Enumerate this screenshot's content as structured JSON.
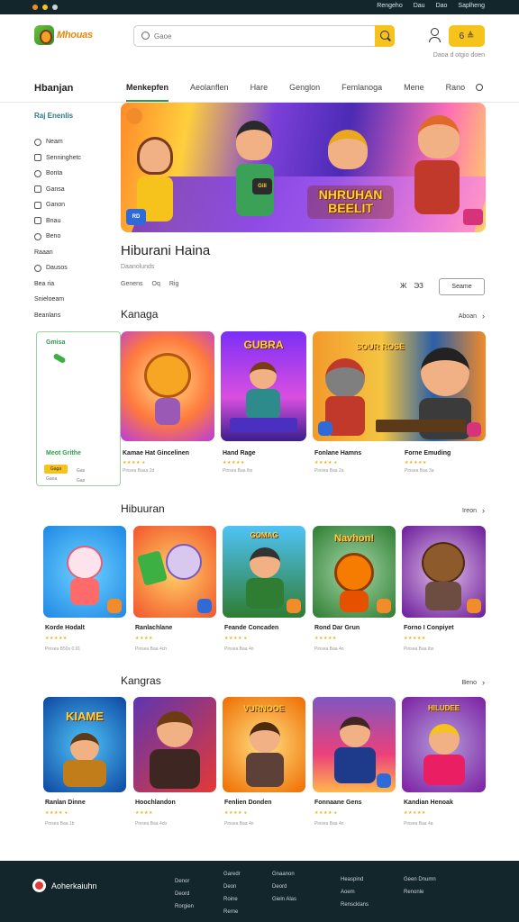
{
  "colors": {
    "topbar": "#13262b",
    "accent": "#f6c21c",
    "green": "#2e9d4a",
    "teal": "#2b7a8c"
  },
  "topbar": {
    "links": [
      "Rengeho",
      "Dau",
      "Dao",
      "Saplheng"
    ]
  },
  "header": {
    "logo_text": "Mhouas",
    "search_placeholder": "Gaoe",
    "cart_label": "6 ≜",
    "sub_note": "Daoa d otgio doen"
  },
  "nav": {
    "side_title": "Hbanjan",
    "tabs": [
      "Menkepfen",
      "Aeolanflen",
      "Hare",
      "Genglon",
      "Femlanoga",
      "Mene",
      "Rano"
    ]
  },
  "sidebar": {
    "head": "Raj Enenlis",
    "items": [
      {
        "label": "Neam",
        "icon": "clock-icon"
      },
      {
        "label": "Senninghetc",
        "icon": "grid-icon"
      },
      {
        "label": "Bonta",
        "icon": "compass-icon"
      },
      {
        "label": "Gansa",
        "icon": "folder-icon"
      },
      {
        "label": "Ganon",
        "icon": "calendar-icon"
      },
      {
        "label": "Bnau",
        "icon": "image-icon"
      },
      {
        "label": "Beno",
        "icon": "settings-icon"
      },
      {
        "label": "Raaan",
        "icon": ""
      },
      {
        "label": "Dausos",
        "icon": "help-icon"
      },
      {
        "label": "Bea ria",
        "icon": ""
      },
      {
        "label": "Snieloeam",
        "icon": ""
      },
      {
        "label": "Beanlans",
        "icon": ""
      }
    ]
  },
  "hero": {
    "title": "NHRUHAN BEELIT",
    "badge_left": "RD",
    "sign": "Gill"
  },
  "detail": {
    "title": "Hiburani Haina",
    "rating": "Daanolunds",
    "meta": [
      "Genens",
      "Oq",
      "Rig"
    ],
    "share": [
      "Ж",
      "ЭЗ"
    ],
    "button": "Seame"
  },
  "sections": [
    {
      "title": "Kanaga",
      "see_all": "Aboan",
      "promo": {
        "title": "Gmisa",
        "name": "Meot Grithe",
        "badge": "Gaga",
        "meta": "Gaoa",
        "meta2": "Gas\nGas"
      },
      "cards": [
        {
          "name": "Kamae Hat Gincelinen",
          "stars": "★★★★ ●",
          "sub": "Pinsea Baaa 2d",
          "label": ""
        },
        {
          "name": "Hand Rage",
          "stars": "★★★★★",
          "sub": "Pinsea Baa lbs",
          "label": "GUBRA"
        },
        {
          "name": "Fonlane Hamns",
          "stars": "★★★★ ●",
          "sub": "Pinsea Baa 2a",
          "label": "SOUR ROSE"
        },
        {
          "name": "Forne Emuding",
          "stars": "★★★★★",
          "sub": "Pinsea Baa 3a",
          "label": ""
        }
      ]
    },
    {
      "title": "Hibuuran",
      "see_all": "Ireon",
      "cards": [
        {
          "name": "Korde Hodalt",
          "stars": "★★★★★",
          "sub": "Pinsea B50s 0.91",
          "label": ""
        },
        {
          "name": "Ranlachlane",
          "stars": "★★★★",
          "sub": "Pinsea Baa 4ch",
          "label": ""
        },
        {
          "name": "Feande Concaden",
          "stars": "★★★★ ●",
          "sub": "Pinsea Baa 4n",
          "label": "GOMAG"
        },
        {
          "name": "Rond Dar Grun",
          "stars": "★★★★★",
          "sub": "Pinsea Baa 4n",
          "label": "Navhon!"
        },
        {
          "name": "Forno I Conpiyet",
          "stars": "★★★★★",
          "sub": "Pinsea Baa lbs",
          "label": ""
        }
      ]
    },
    {
      "title": "Kangras",
      "see_all": "Beno",
      "cards": [
        {
          "name": "Ranlan Dinne",
          "stars": "★★★★ ●",
          "sub": "Pinsea Baa 1b",
          "label": "KIAME"
        },
        {
          "name": "Hoochlandon",
          "stars": "★★★★",
          "sub": "Pinsea Baa 4cb",
          "label": ""
        },
        {
          "name": "Fenlien Donden",
          "stars": "★★★★ ●",
          "sub": "Pinsea Baa 4n",
          "label": "VURNOOE"
        },
        {
          "name": "Fonnaane Gens",
          "stars": "★★★★ ●",
          "sub": "Pinsea Baa 4n",
          "label": ""
        },
        {
          "name": "Kandian Henoak",
          "stars": "★★★★★",
          "sub": "Pinsea Baa 4a",
          "label": "HILUDEE"
        }
      ]
    }
  ],
  "footer": {
    "brand": "Aoherkaiuhn",
    "col1": [
      "Denor",
      "Deord",
      "Rorgien"
    ],
    "col2": [
      "Garedr",
      "Deon",
      "Roine",
      "Rerne"
    ],
    "col3": [
      "Gnaanon",
      "Deord",
      "Gieln Alas"
    ],
    "col4": [
      "Heaspind",
      "Aoem",
      "Renscklans"
    ],
    "col5": [
      "Geen Dnumn",
      "Renonle"
    ]
  }
}
